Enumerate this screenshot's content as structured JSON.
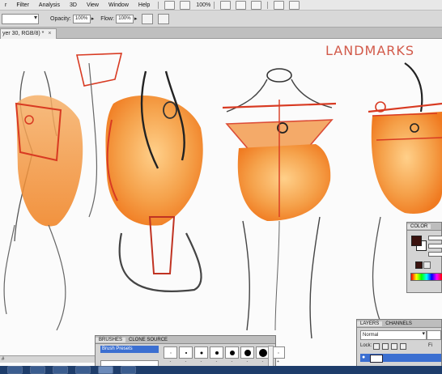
{
  "menu": {
    "items": [
      "r",
      "Filter",
      "Analysis",
      "3D",
      "View",
      "Window",
      "Help"
    ],
    "zoom": "100%"
  },
  "options_bar": {
    "opacity_label": "Opacity:",
    "opacity_value": "100%",
    "flow_label": "Flow:",
    "flow_value": "100%"
  },
  "document_tab": {
    "title": "yer 30, RGB/8) *",
    "close": "×"
  },
  "canvas": {
    "annotation": "LANDMARKS"
  },
  "color_panel": {
    "tab": "COLOR",
    "foreground": "#3a120e",
    "background": "#ffffff"
  },
  "brushes_panel": {
    "tabs": [
      "BRUSHES",
      "CLONE SOURCE"
    ],
    "selected": "Brush Presets",
    "tip_sizes": [
      "-",
      "-",
      "-",
      "-",
      "-",
      "-",
      "-",
      "+"
    ]
  },
  "layers_panel": {
    "tabs": [
      "LAYERS",
      "CHANNELS"
    ],
    "blend_mode": "Normal",
    "lock_label": "Lock:",
    "fill_label": "Fi"
  },
  "status": {
    "label": "#"
  },
  "colors": {
    "menubar": "#e8e8e8",
    "selection": "#3b6fd1",
    "sketch_orange": "#f28a1c",
    "sketch_red": "#d83a22"
  }
}
